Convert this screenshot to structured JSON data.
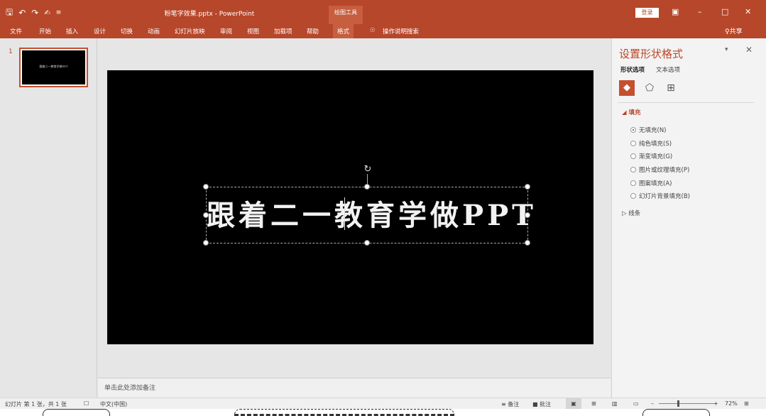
{
  "app": {
    "doc_title": "粉笔字效果.pptx  -  PowerPoint",
    "tools_group": "绘图工具",
    "login": "登录",
    "share": "共享"
  },
  "icons": {
    "save": "save-icon",
    "undo": "undo-icon",
    "redo": "redo-icon",
    "customize": "customize-qat-icon",
    "tell_me": "lightbulb-icon"
  },
  "ribbon": {
    "tabs": [
      "文件",
      "开始",
      "插入",
      "设计",
      "切换",
      "动画",
      "幻灯片放映",
      "审阅",
      "视图",
      "加载项",
      "帮助",
      "格式"
    ],
    "tell_me": "操作说明搜索"
  },
  "thumbnails": {
    "number": "1",
    "preview_text": "跟着二一教育学做PPT"
  },
  "slide": {
    "text": "跟着二一教育学做PPT",
    "notes_placeholder": "单击此处添加备注"
  },
  "format_pane": {
    "title": "设置形状格式",
    "tab_shape": "形状选项",
    "tab_text": "文本选项",
    "section_fill": "填充",
    "fill_options": [
      {
        "label": "无填充(N)",
        "selected": true
      },
      {
        "label": "纯色填充(S)",
        "selected": false
      },
      {
        "label": "渐变填充(G)",
        "selected": false
      },
      {
        "label": "图片或纹理填充(P)",
        "selected": false
      },
      {
        "label": "图案填充(A)",
        "selected": false
      },
      {
        "label": "幻灯片背景填充(B)",
        "selected": false
      }
    ],
    "section_line": "线条"
  },
  "status": {
    "slide_info": "幻灯片 第 1 张，共 1 张",
    "language": "中文(中国)",
    "notes": "备注",
    "comments": "批注",
    "zoom": "72%",
    "zoom_level_percent": 72
  },
  "colors": {
    "accent": "#b7472a",
    "accent_light": "#c65e3f",
    "slide_bg": "#000000",
    "text_chalk": "#f2f2f2"
  }
}
